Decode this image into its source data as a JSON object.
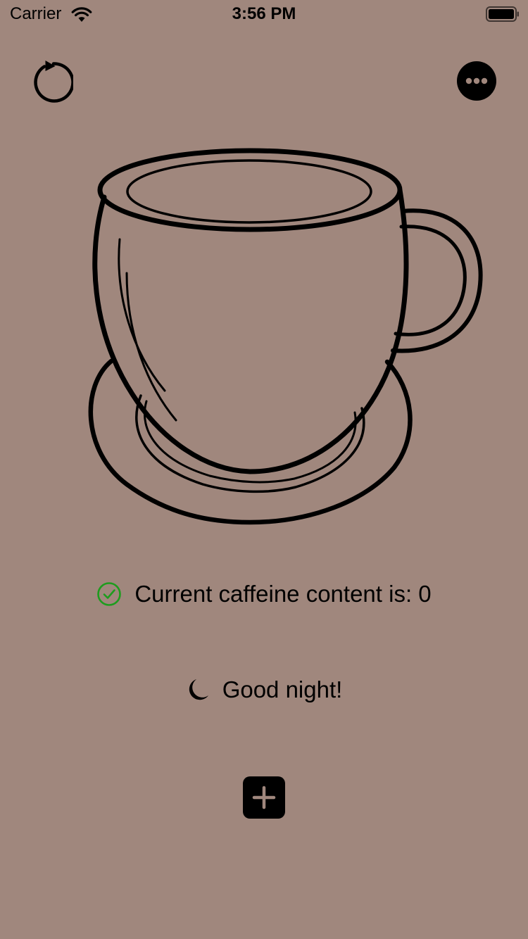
{
  "status_bar": {
    "carrier": "Carrier",
    "time": "3:56 PM",
    "wifi_icon": "wifi-icon",
    "battery_icon": "battery-icon"
  },
  "toolbar": {
    "refresh_icon": "refresh-icon",
    "more_icon": "more-icon"
  },
  "illustration": {
    "name": "coffee-cup-illustration"
  },
  "caffeine_status": {
    "icon": "checkmark-circle-icon",
    "icon_color": "#1e9c1e",
    "text": "Current caffeine content is: 0"
  },
  "greeting": {
    "icon": "moon-icon",
    "text": "Good night!"
  },
  "add_button": {
    "icon": "plus-icon"
  },
  "colors": {
    "background": "#a0877d"
  }
}
